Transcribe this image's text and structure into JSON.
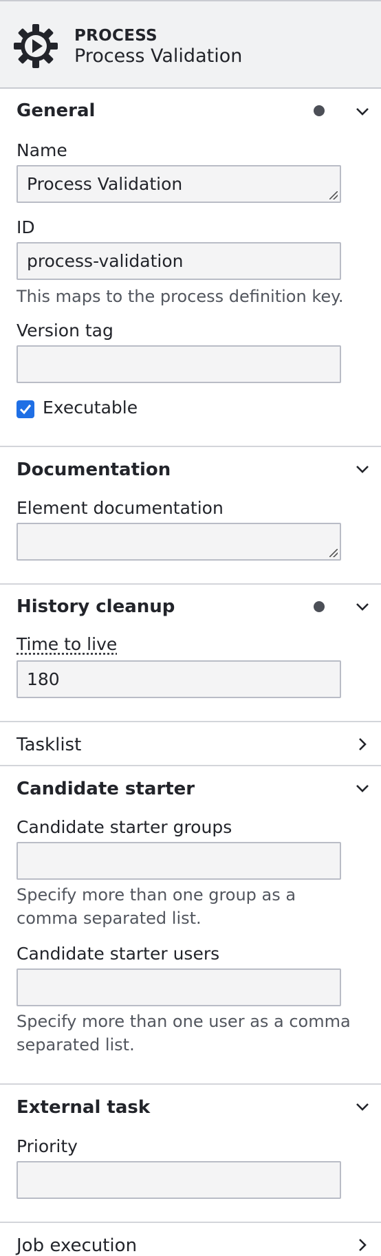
{
  "header": {
    "type": "PROCESS",
    "name": "Process Validation"
  },
  "general": {
    "title": "General",
    "name_label": "Name",
    "name_value": "Process Validation",
    "id_label": "ID",
    "id_value": "process-validation",
    "id_description": "This maps to the process definition key.",
    "version_label": "Version tag",
    "version_value": "",
    "executable_label": "Executable",
    "executable_checked": true
  },
  "documentation": {
    "title": "Documentation",
    "element_label": "Element documentation",
    "element_value": ""
  },
  "history": {
    "title": "History cleanup",
    "ttl_label": "Time to live",
    "ttl_value": "180"
  },
  "tasklist": {
    "title": "Tasklist"
  },
  "candidate": {
    "title": "Candidate starter",
    "groups_label": "Candidate starter groups",
    "groups_value": "",
    "groups_desc_line1": "Specify more than one group as a",
    "groups_desc_line2": "comma separated list.",
    "users_label": "Candidate starter users",
    "users_value": "",
    "users_desc_line1": "Specify more than one user as a comma",
    "users_desc_line2": "separated list."
  },
  "external": {
    "title": "External task",
    "priority_label": "Priority",
    "priority_value": ""
  },
  "job": {
    "title": "Job execution"
  },
  "icons": {
    "header": "process-gear-play-icon",
    "expanded": "chevron-down-icon",
    "collapsed": "chevron-right-icon",
    "has_entries": "entries-dot-icon",
    "check": "checkmark-icon"
  },
  "colors": {
    "accent": "#1f6fe5",
    "header_bg": "#f1f2f3",
    "input_bg": "#f4f4f5"
  }
}
